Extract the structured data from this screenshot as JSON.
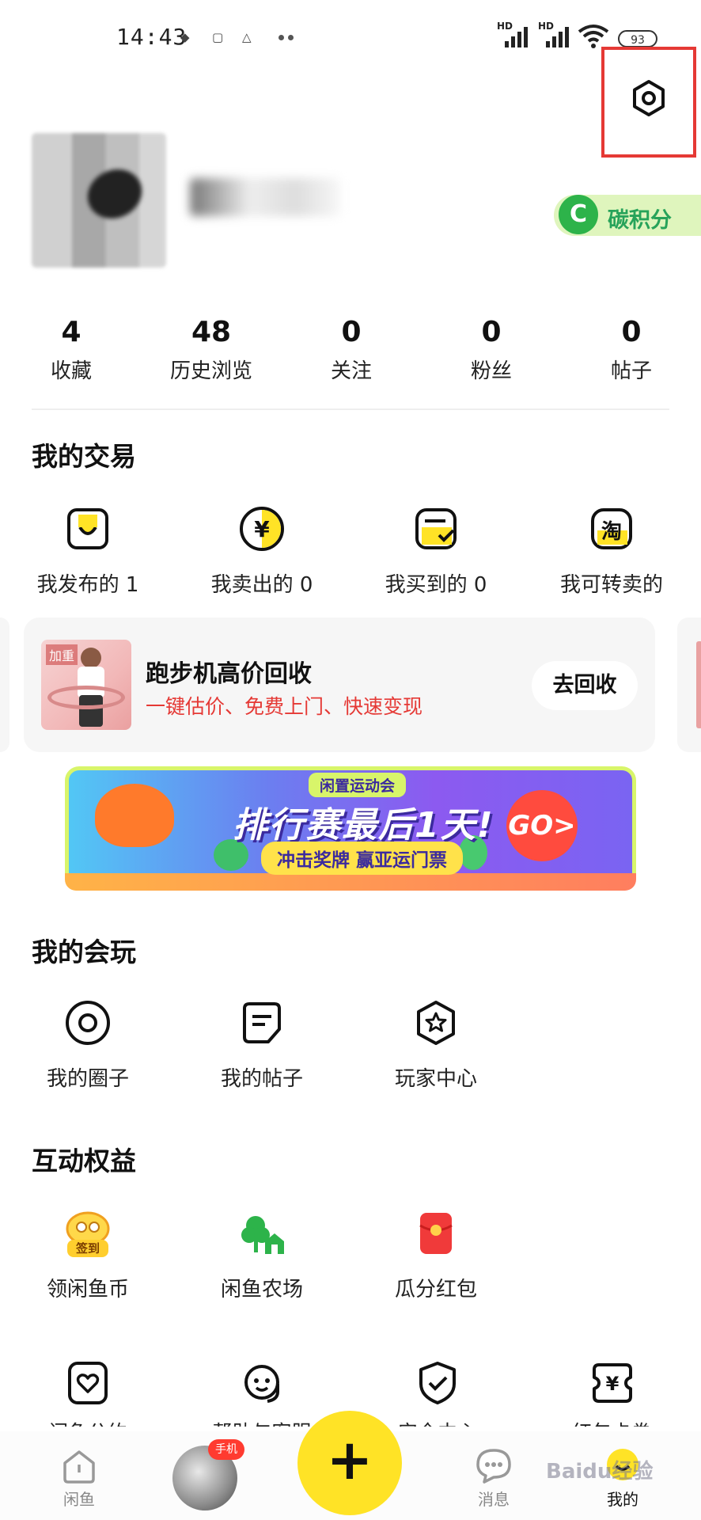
{
  "status_bar": {
    "time": "14:43",
    "net1": "HD",
    "net2": "HD",
    "battery": "93"
  },
  "profile": {
    "carbon_icon": "C",
    "carbon_label": "碳积分"
  },
  "stats": [
    {
      "value": "4",
      "label": "收藏"
    },
    {
      "value": "48",
      "label": "历史浏览"
    },
    {
      "value": "0",
      "label": "关注"
    },
    {
      "value": "0",
      "label": "粉丝"
    },
    {
      "value": "0",
      "label": "帖子"
    }
  ],
  "trade": {
    "title": "我的交易",
    "items": [
      {
        "label": "我发布的 1",
        "icon": "published-icon"
      },
      {
        "label": "我卖出的 0",
        "icon": "sold-icon"
      },
      {
        "label": "我买到的 0",
        "icon": "bought-icon"
      },
      {
        "label": "我可转卖的",
        "icon": "taobao-resell-icon"
      }
    ]
  },
  "recycle_card": {
    "image_tag": "加重",
    "title": "跑步机高价回收",
    "subtitle": "一键估价、免费上门、快速变现",
    "button": "去回收"
  },
  "banner": {
    "tag": "闲置运动会",
    "main": "排行赛最后1天!",
    "sub": "冲击奖牌 赢亚运门票",
    "go": "GO>"
  },
  "play": {
    "title": "我的会玩",
    "items": [
      {
        "label": "我的圈子",
        "icon": "circle-icon"
      },
      {
        "label": "我的帖子",
        "icon": "post-icon"
      },
      {
        "label": "玩家中心",
        "icon": "player-center-icon"
      }
    ]
  },
  "benefits": {
    "title": "互动权益",
    "items": [
      {
        "label": "领闲鱼币",
        "icon": "checkin-coin-icon",
        "badge": "签到"
      },
      {
        "label": "闲鱼农场",
        "icon": "farm-icon"
      },
      {
        "label": "瓜分红包",
        "icon": "red-packet-icon"
      }
    ]
  },
  "shortcuts": [
    {
      "label": "闲鱼公约",
      "icon": "heart-doc-icon"
    },
    {
      "label": "帮助与客服",
      "icon": "customer-service-icon"
    },
    {
      "label": "安全中心",
      "icon": "shield-check-icon"
    },
    {
      "label": "红包卡券",
      "icon": "coupon-icon"
    }
  ],
  "tabbar": {
    "home": "闲鱼",
    "badge": "手机",
    "messages": "消息",
    "me": "我的"
  },
  "watermark": "Baidu经验",
  "colors": {
    "accent_yellow": "#ffe326",
    "red": "#e53935",
    "green": "#2db34a"
  }
}
